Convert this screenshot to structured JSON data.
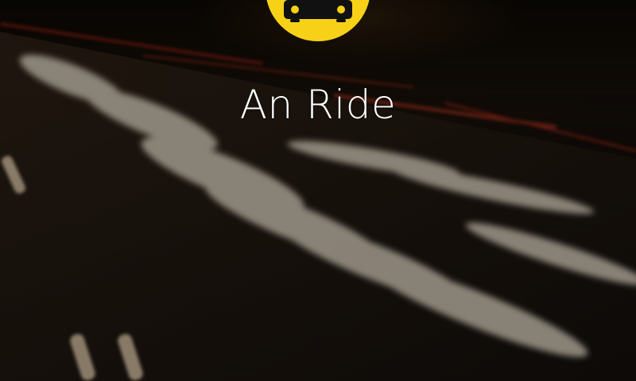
{
  "app": {
    "title": "An Ride",
    "logo_icon": "car-icon"
  },
  "colors": {
    "brand_yellow": "#f7d117",
    "logo_glyph": "#111111",
    "title_text": "#ffffff"
  }
}
